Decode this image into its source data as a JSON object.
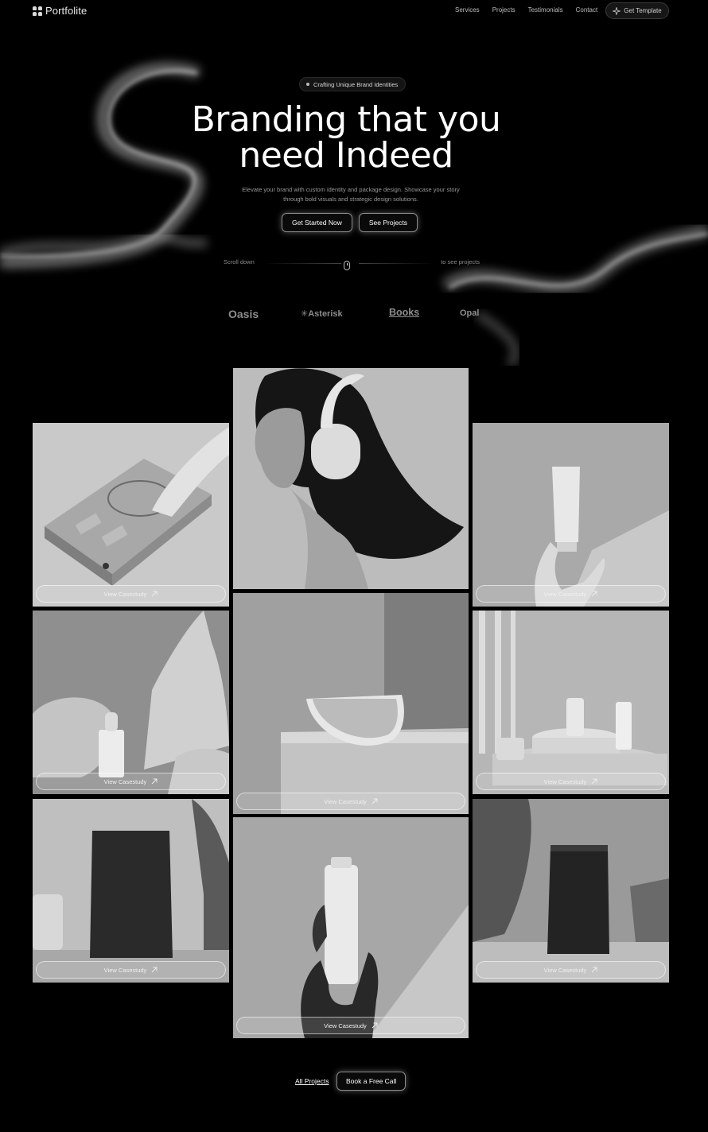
{
  "nav": {
    "logo_text": "Portfolite",
    "links": [
      "Services",
      "Projects",
      "Testimonials",
      "Contact"
    ],
    "cta_label": "Get Template",
    "cta_icon": "sparkle-icon"
  },
  "hero": {
    "pill": "Crafting Unique Brand Identities",
    "title_line1": "Branding that you",
    "title_line2": "need Indeed",
    "subtitle": "Elevate your brand with custom identity and package design. Showcase your story through bold visuals and strategic design solutions.",
    "primary_button": "Get Started Now",
    "secondary_button": "See Projects",
    "scroll_left": "Scroll down",
    "scroll_right": "to see projects",
    "scroll_icon": "mouse-icon"
  },
  "brands": [
    "Oasis",
    "✳Asterisk",
    "Books",
    "Opal"
  ],
  "gallery": {
    "button_label": "View Casestudy",
    "button_icon": "arrow-up-right-icon",
    "cards": [
      {
        "subject": "Portable music device with a finger pressing a button"
      },
      {
        "subject": "Woman wearing headphones"
      },
      {
        "subject": "Hand holding a cosmetic tube"
      },
      {
        "subject": "Dropper bottle among rocks"
      },
      {
        "subject": "Orange slice on a pedestal"
      },
      {
        "subject": "Skincare products on a round stand"
      },
      {
        "subject": "Dark pouch package with plants"
      },
      {
        "subject": "Gloved hand holding a bottle"
      },
      {
        "subject": "Dark coffee bag with plants"
      }
    ]
  },
  "footer": {
    "all_projects": "All Projects",
    "book_call": "Book a Free Call"
  }
}
